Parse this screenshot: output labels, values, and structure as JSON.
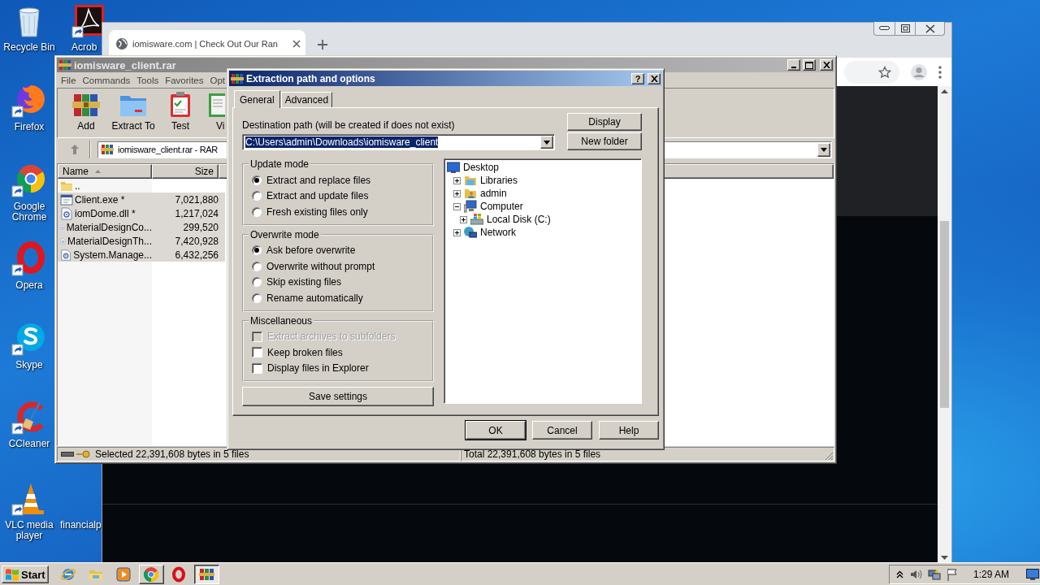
{
  "desktop_icons": [
    {
      "kind": "recycle",
      "label": "Recycle Bin"
    },
    {
      "kind": "acrobat",
      "label": "Acrob"
    },
    {
      "kind": "firefox",
      "label": "Firefox"
    },
    {
      "kind": "chrome",
      "label": "Google Chrome"
    },
    {
      "kind": "opera",
      "label": "Opera"
    },
    {
      "kind": "skype",
      "label": "Skype"
    },
    {
      "kind": "ccleaner",
      "label": "CCleaner"
    },
    {
      "kind": "vlc",
      "label": "VLC media player"
    },
    {
      "kind": "file",
      "label": "financialp"
    }
  ],
  "browser": {
    "tab_title": "iomisware.com | Check Out Our Ran"
  },
  "archive_window": {
    "title": "iomisware_client.rar",
    "menu": [
      "File",
      "Commands",
      "Tools",
      "Favorites",
      "Opt"
    ],
    "toolbar": [
      {
        "kind": "add",
        "label": "Add"
      },
      {
        "kind": "extract",
        "label": "Extract To"
      },
      {
        "kind": "test",
        "label": "Test"
      },
      {
        "kind": "view",
        "label": "Vi"
      }
    ],
    "path": "iomisware_client.rar - RAR",
    "columns": [
      {
        "label": "Name",
        "sorted": true
      },
      {
        "label": "Size",
        "sorted": false
      }
    ],
    "rows": [
      {
        "kind": "parent",
        "name": "..",
        "selected": false
      },
      {
        "kind": "exe",
        "name": "Client.exe *",
        "size": "7,021,880",
        "selected": true
      },
      {
        "kind": "dll",
        "name": "iomDome.dll *",
        "size": "1,217,024",
        "selected": true
      },
      {
        "kind": "dll",
        "name": "MaterialDesignCo...",
        "size": "299,520",
        "selected": true
      },
      {
        "kind": "dll",
        "name": "MaterialDesignTh...",
        "size": "7,420,928",
        "selected": true
      },
      {
        "kind": "dll",
        "name": "System.Manage...",
        "size": "6,432,256",
        "selected": true
      }
    ],
    "status": [
      "Selected 22,391,608 bytes in 5 files",
      "Total 22,391,608 bytes in 5 files"
    ]
  },
  "dialog": {
    "title": "Extraction path and options",
    "help": "?",
    "tabs": [
      {
        "label": "General",
        "selected": true
      },
      {
        "label": "Advanced",
        "selected": false
      }
    ],
    "path_label": "Destination path (will be created if does not exist)",
    "path": "C:\\Users\\admin\\Downloads\\iomisware_client",
    "path_highlighted": true,
    "side_buttons": [
      "Display",
      "New folder"
    ],
    "groups": [
      {
        "title": "Update mode",
        "kind": "radio",
        "options": [
          {
            "label": "Extract and replace files",
            "selected": true
          },
          {
            "label": "Extract and update files",
            "selected": false
          },
          {
            "label": "Fresh existing files only",
            "selected": false
          }
        ]
      },
      {
        "title": "Overwrite mode",
        "kind": "radio",
        "options": [
          {
            "label": "Ask before overwrite",
            "selected": true
          },
          {
            "label": "Overwrite without prompt",
            "selected": false
          },
          {
            "label": "Skip existing files",
            "selected": false
          },
          {
            "label": "Rename automatically",
            "selected": false
          }
        ]
      },
      {
        "title": "Miscellaneous",
        "kind": "check",
        "options": [
          {
            "label": "Extract archives to subfolders",
            "checked": false,
            "disabled": true
          },
          {
            "label": "Keep broken files",
            "checked": false,
            "disabled": false
          },
          {
            "label": "Display files in Explorer",
            "checked": false,
            "disabled": false
          }
        ]
      }
    ],
    "save_button": "Save settings",
    "tree": [
      {
        "kind": "desktop",
        "label": "Desktop",
        "children": [
          {
            "kind": "library",
            "label": "Libraries",
            "expanded": false
          },
          {
            "kind": "user",
            "label": "admin",
            "expanded": false
          },
          {
            "kind": "computer",
            "label": "Computer",
            "expanded": true,
            "children": [
              {
                "kind": "disk",
                "label": "Local Disk (C:)",
                "expanded": false
              }
            ]
          },
          {
            "kind": "network",
            "label": "Network",
            "expanded": false
          }
        ]
      }
    ],
    "buttons": [
      "OK",
      "Cancel",
      "Help"
    ]
  },
  "taskbar": {
    "start": "Start",
    "apps": [
      {
        "kind": "ie",
        "open": false,
        "selected": false
      },
      {
        "kind": "explorer",
        "open": false,
        "selected": false
      },
      {
        "kind": "media",
        "open": false,
        "selected": false
      },
      {
        "kind": "chrome",
        "open": true,
        "selected": false
      },
      {
        "kind": "opera",
        "open": false,
        "selected": false
      },
      {
        "kind": "winrar",
        "open": true,
        "selected": true
      }
    ],
    "clock": "1:29 AM"
  }
}
